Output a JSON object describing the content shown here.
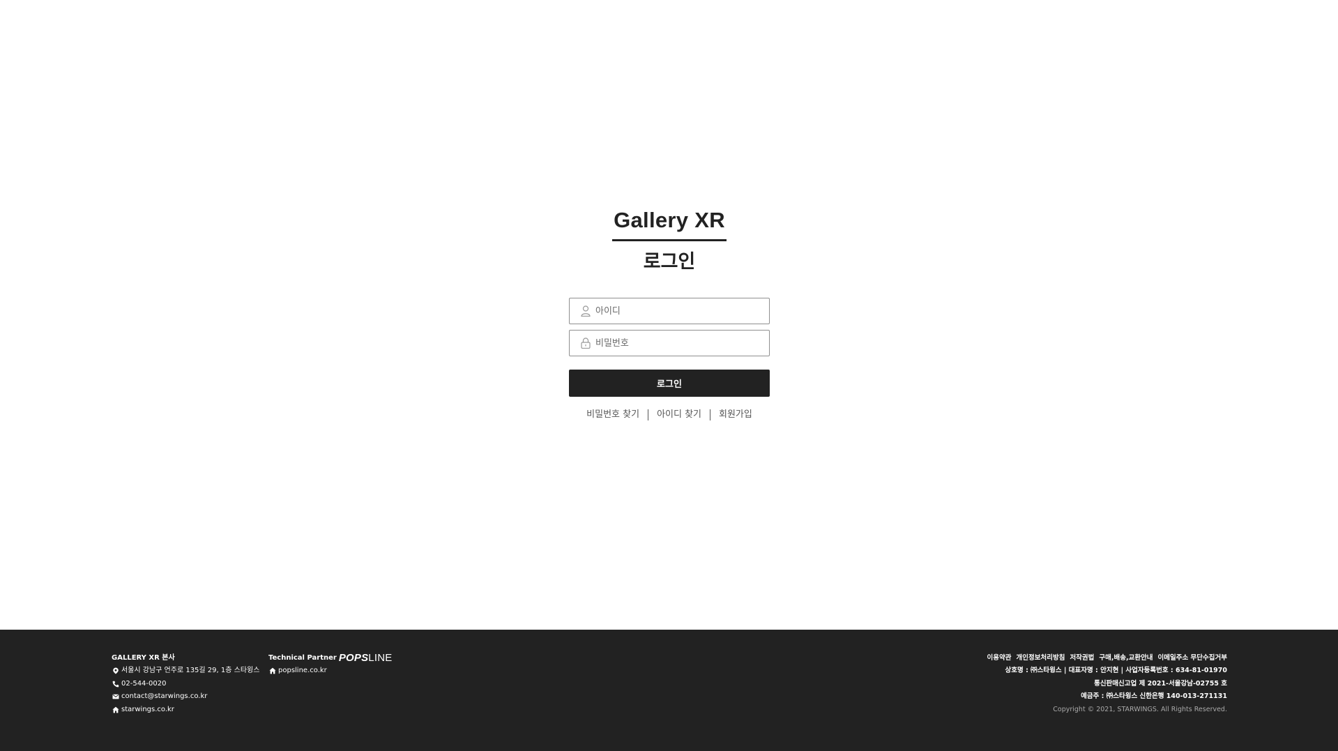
{
  "brand": {
    "title": "Gallery XR"
  },
  "login": {
    "title": "로그인",
    "id_placeholder": "아이디",
    "password_placeholder": "비밀번호",
    "submit_label": "로그인",
    "links": {
      "find_password": "비밀번호 찾기",
      "find_id": "아이디 찾기",
      "signup": "회원가입"
    }
  },
  "footer": {
    "hq": {
      "title": "GALLERY XR 본사",
      "address": "서울시 강남구 언주로 135길 29, 1층 스타윙스",
      "phone": "02-544-0020",
      "email": "contact@starwings.co.kr",
      "website": "starwings.co.kr"
    },
    "partner": {
      "label": "Technical Partner",
      "logo_bold": "POPS",
      "logo_light": "LINE",
      "website": "popsline.co.kr"
    },
    "policy_links": [
      "이용약관",
      "개인정보처리방침",
      "저작권법",
      "구매,배송,교환안내",
      "이메일주소 무단수집거부"
    ],
    "company_info": "상호명 : ㈜스타윙스 | 대표자명 : 안지현 | 사업자등록번호 : 634-81-01970",
    "mail_order": "통신판매신고업 제 2021-서울강남-02755 호",
    "account": "예금주 : ㈜스타윙스 신한은행 140-013-271131",
    "copyright": "Copyright © 2021, STARWINGS. All Rights Reserved."
  },
  "colors": {
    "dark": "#222222",
    "border": "#8f8f8f",
    "muted_text": "#555555"
  }
}
